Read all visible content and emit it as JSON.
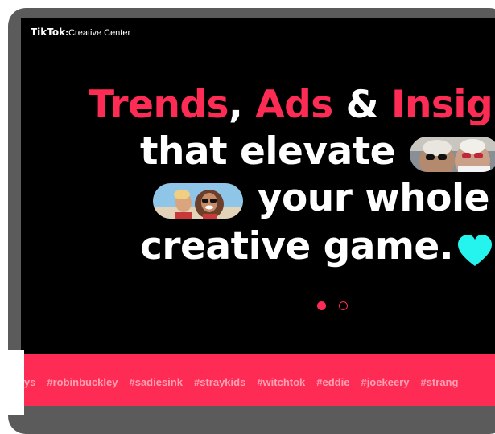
{
  "logo": {
    "brand": "TikTok",
    "separator": ":",
    "product": "Creative Center"
  },
  "headline": {
    "line1": {
      "part1": "Trends",
      "part2": ", ",
      "part3": "Ads",
      "part4": " & ",
      "part5": "Insigh"
    },
    "line2": "that elevate",
    "line3": "your whole",
    "line4": "creative game."
  },
  "carousel": {
    "total_slides": 2,
    "active_slide": 1
  },
  "hashtags": [
    "boys",
    "#robinbuckley",
    "#sadiesink",
    "#straykids",
    "#witchtok",
    "#eddie",
    "#joekeery",
    "#strang"
  ],
  "colors": {
    "accent": "#fe2c55",
    "heart": "#25f4ee",
    "background": "#000000",
    "bezel": "#5b5b5b"
  },
  "icons": {
    "heart": "heart-icon"
  }
}
